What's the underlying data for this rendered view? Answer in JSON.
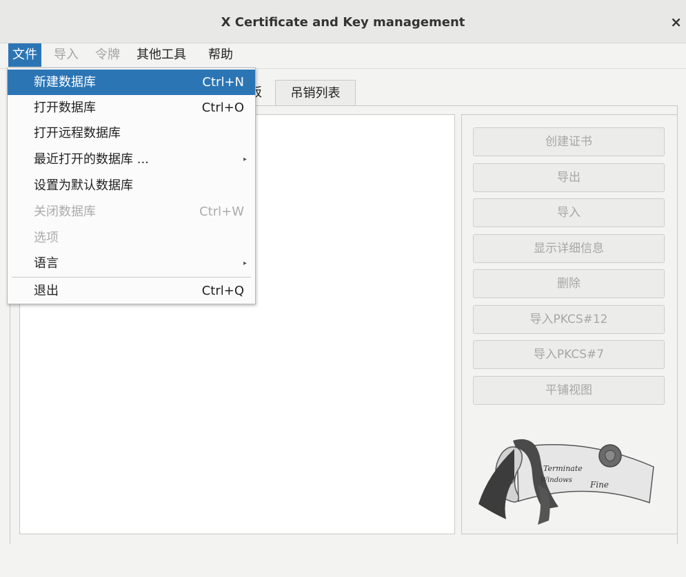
{
  "window": {
    "title": "X Certificate and Key management",
    "close_glyph": "×"
  },
  "menubar": {
    "items": [
      {
        "label": "文件",
        "state": "active"
      },
      {
        "label": "导入",
        "state": "disabled"
      },
      {
        "label": "令牌",
        "state": "disabled"
      },
      {
        "label": "其他工具",
        "state": "enabled"
      },
      {
        "label": "帮助",
        "state": "enabled"
      }
    ]
  },
  "file_menu": {
    "items": [
      {
        "label": "新建数据库",
        "shortcut": "Ctrl+N",
        "state": "selected"
      },
      {
        "label": "打开数据库",
        "shortcut": "Ctrl+O",
        "state": "enabled"
      },
      {
        "label": "打开远程数据库",
        "shortcut": "",
        "state": "enabled"
      },
      {
        "label": "最近打开的数据库 ...",
        "shortcut": "",
        "state": "enabled",
        "submenu": true
      },
      {
        "label": "设置为默认数据库",
        "shortcut": "",
        "state": "enabled"
      },
      {
        "label": "关闭数据库",
        "shortcut": "Ctrl+W",
        "state": "disabled"
      },
      {
        "label": "选项",
        "shortcut": "",
        "state": "disabled"
      },
      {
        "label": "语言",
        "shortcut": "",
        "state": "enabled",
        "submenu": true
      },
      {
        "label": "退出",
        "shortcut": "Ctrl+Q",
        "state": "enabled"
      }
    ],
    "submenu_arrow": "▸"
  },
  "tabs": {
    "partial_label": "板",
    "crl_label": "吊销列表"
  },
  "actions": [
    {
      "label": "创建证书"
    },
    {
      "label": "导出"
    },
    {
      "label": "导入"
    },
    {
      "label": "显示详细信息"
    },
    {
      "label": "删除"
    },
    {
      "label": "导入PKCS#12"
    },
    {
      "label": "导入PKCS#7"
    },
    {
      "label": "平铺视图"
    }
  ],
  "logo": {
    "line1": "Terminate",
    "line2": "Windows",
    "line3": "Fine"
  },
  "colors": {
    "accent": "#2c75b5",
    "disabled_text": "#a6a6a6",
    "background": "#f3f3f2"
  }
}
